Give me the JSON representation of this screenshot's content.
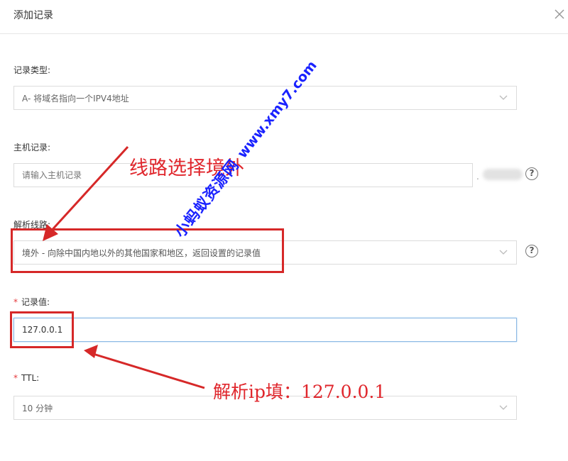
{
  "dialog": {
    "title": "添加记录"
  },
  "form": {
    "record_type": {
      "label": "记录类型:",
      "value": "A- 将域名指向一个IPV4地址"
    },
    "host": {
      "label": "主机记录:",
      "placeholder": "请输入主机记录",
      "suffix": "."
    },
    "line": {
      "label": "解析线路:",
      "value": "境外 - 向除中国内地以外的其他国家和地区，返回设置的记录值"
    },
    "value": {
      "required": "*",
      "label": "记录值:",
      "value": "127.0.0.1"
    },
    "ttl": {
      "required": "*",
      "label": "TTL:",
      "value": "10 分钟"
    }
  },
  "annotations": {
    "line_note": "线路选择境外",
    "ip_note": "解析ip填：127.0.0.1",
    "color": "#e0262c"
  },
  "watermark": {
    "name": "小蚂蚁资源网",
    "url": "www.xmy7.com",
    "color": "#1a22ff"
  },
  "icons": {
    "close": "close-icon",
    "help": "help-circle-icon",
    "chevron": "chevron-down-icon"
  }
}
